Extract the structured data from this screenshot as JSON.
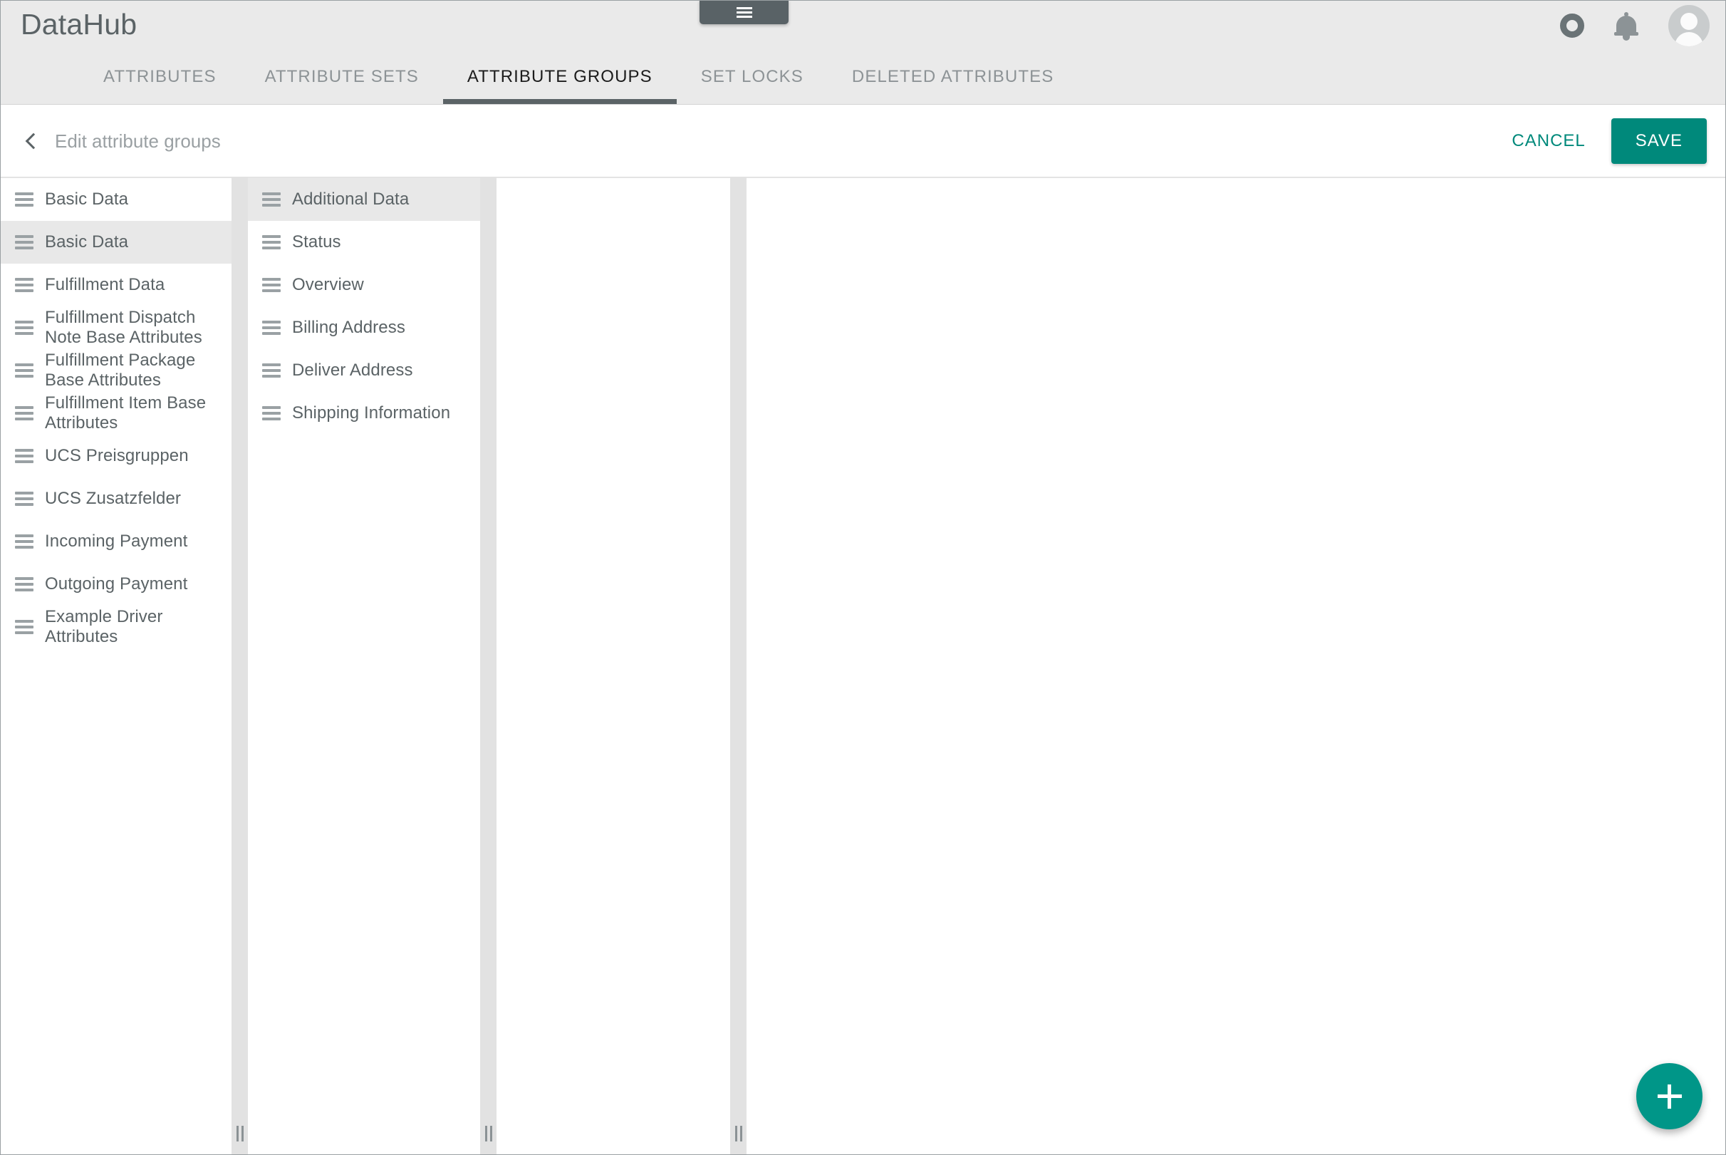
{
  "app": {
    "brand": "DataHub"
  },
  "header": {
    "menu_tab_icon": "hamburger-icon",
    "icons": [
      {
        "name": "record-ring-icon",
        "label": ""
      },
      {
        "name": "notifications-bell-icon",
        "label": ""
      },
      {
        "name": "user-avatar",
        "label": ""
      }
    ],
    "tabs": [
      {
        "label": "ATTRIBUTES",
        "active": false
      },
      {
        "label": "ATTRIBUTE SETS",
        "active": false
      },
      {
        "label": "ATTRIBUTE GROUPS",
        "active": true
      },
      {
        "label": "SET LOCKS",
        "active": false
      },
      {
        "label": "DELETED ATTRIBUTES",
        "active": false
      }
    ]
  },
  "subbar": {
    "back_icon": "chevron-left-icon",
    "title": "Edit attribute groups",
    "cancel_label": "CANCEL",
    "save_label": "SAVE"
  },
  "columns": {
    "column1": {
      "items": [
        {
          "label": "Basic Data",
          "selected": false
        },
        {
          "label": "Basic Data",
          "selected": true
        },
        {
          "label": "Fulfillment Data",
          "selected": false
        },
        {
          "label": "Fulfillment Dispatch Note Base Attributes",
          "selected": false
        },
        {
          "label": "Fulfillment Package Base Attributes",
          "selected": false
        },
        {
          "label": "Fulfillment Item Base Attributes",
          "selected": false
        },
        {
          "label": "UCS Preisgruppen",
          "selected": false
        },
        {
          "label": "UCS Zusatzfelder",
          "selected": false
        },
        {
          "label": "Incoming Payment",
          "selected": false
        },
        {
          "label": "Outgoing Payment",
          "selected": false
        },
        {
          "label": "Example Driver Attributes",
          "selected": false
        }
      ]
    },
    "column2": {
      "items": [
        {
          "label": "Additional Data",
          "selected": true
        },
        {
          "label": "Status",
          "selected": false
        },
        {
          "label": "Overview",
          "selected": false
        },
        {
          "label": "Billing Address",
          "selected": false
        },
        {
          "label": "Deliver Address",
          "selected": false
        },
        {
          "label": "Shipping Information",
          "selected": false
        }
      ]
    },
    "column3": {
      "items": []
    },
    "column4": {
      "items": []
    }
  },
  "fab": {
    "icon": "plus-icon",
    "label": ""
  },
  "colors": {
    "accent": "#00897b",
    "fab": "#009688",
    "header_bg": "#eaeaea",
    "tab_active_underline": "#5b6366",
    "text_muted": "#8d9396",
    "text_primary": "#5b6366",
    "selected_row": "#e8e8e8",
    "divider": "#e2e2e2"
  }
}
